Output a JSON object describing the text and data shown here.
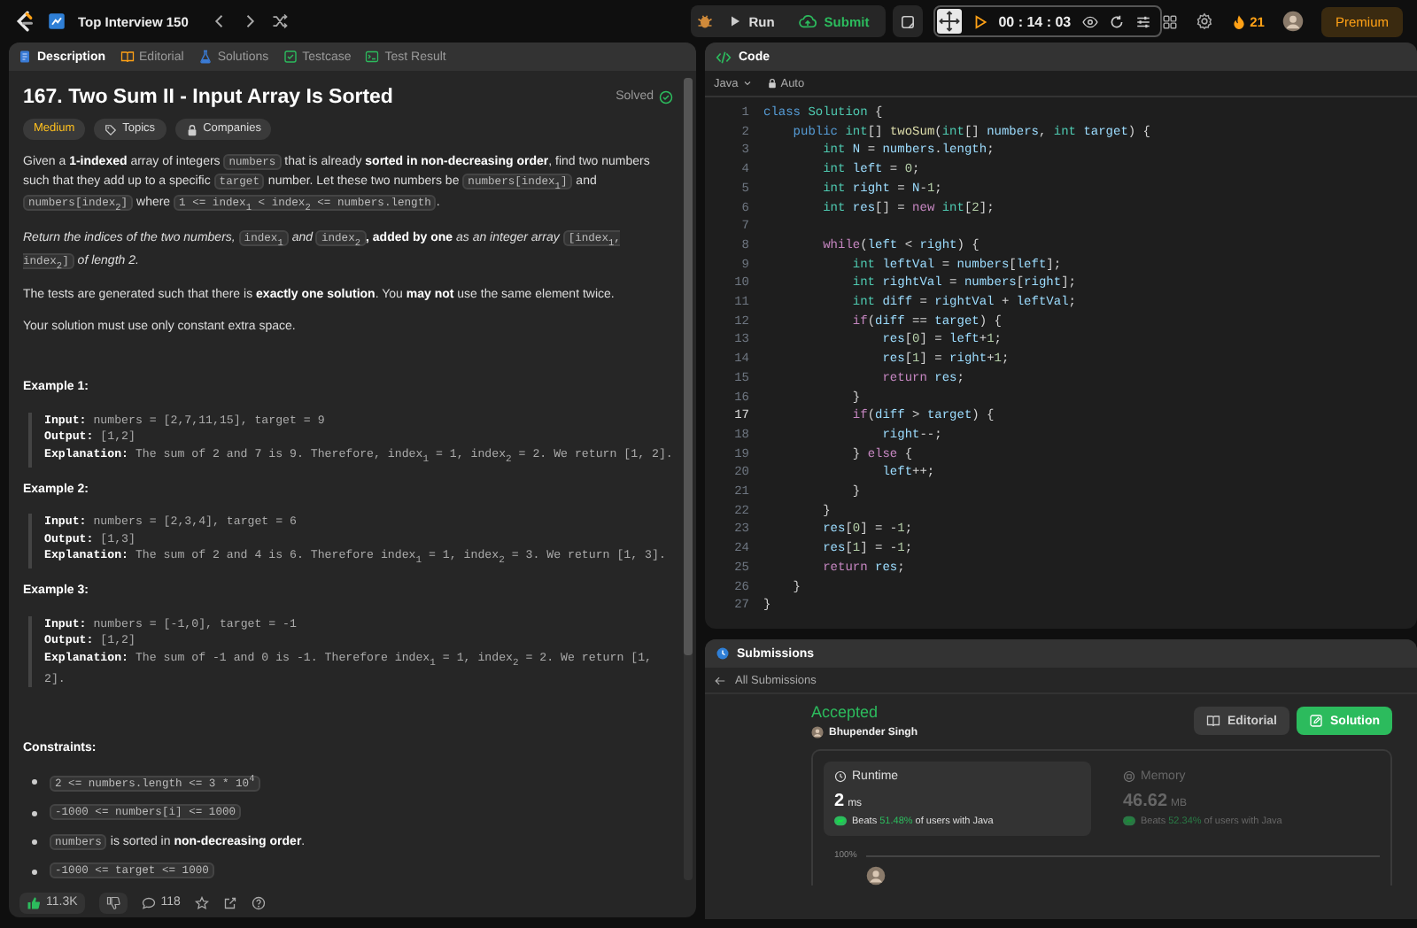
{
  "top_bar": {
    "list_title": "Top Interview 150",
    "run_label": "Run",
    "submit_label": "Submit",
    "timer": "00 : 14 : 03",
    "streak": "21",
    "premium_label": "Premium"
  },
  "left_tabs": [
    {
      "label": "Description",
      "selected": true
    },
    {
      "label": "Editorial",
      "selected": false
    },
    {
      "label": "Solutions",
      "selected": false
    },
    {
      "label": "Testcase",
      "selected": false
    },
    {
      "label": "Test Result",
      "selected": false
    }
  ],
  "problem": {
    "title": "167. Two Sum II - Input Array Is Sorted",
    "status": "Solved",
    "difficulty": "Medium",
    "tags": [
      {
        "label": "Topics",
        "kind": "topic"
      },
      {
        "label": "Companies",
        "kind": "company"
      }
    ],
    "paragraphs": [
      [
        {
          "kind": "text",
          "text": "Given a **1-indexed** array of integers "
        },
        {
          "kind": "code",
          "text": "numbers"
        },
        {
          "kind": "text",
          "text": " that is already **sorted in non-decreasing order**, find two numbers such that they add up to a specific "
        },
        {
          "kind": "code",
          "text": "target"
        },
        {
          "kind": "text",
          "text": " number. Let these two numbers be "
        },
        {
          "kind": "code",
          "text": "numbers[index$_{1}$]"
        },
        {
          "kind": "text",
          "text": " and "
        },
        {
          "kind": "code",
          "text": "numbers[index$_{2}$]"
        },
        {
          "kind": "text",
          "text": " where "
        },
        {
          "kind": "code",
          "text": "1 <= index$_{1}$ < index$_{2}$ <= numbers.length"
        },
        {
          "kind": "text",
          "text": "."
        }
      ],
      [
        {
          "kind": "text",
          "text": "*Return the indices of the two numbers,* "
        },
        {
          "kind": "code",
          "text": "index$_{1}$"
        },
        {
          "kind": "text",
          "text": " *and* "
        },
        {
          "kind": "code",
          "text": "index$_{2}$"
        },
        {
          "kind": "text",
          "text": "**, added by one** *as an integer array* "
        },
        {
          "kind": "code",
          "text": "[index$_{1}$, index$_{2}$]"
        },
        {
          "kind": "text",
          "text": " *of length 2.*"
        }
      ],
      [
        {
          "kind": "text",
          "text": "The tests are generated such that there is **exactly one solution**. You **may not** use the same element twice."
        }
      ],
      [
        {
          "kind": "text",
          "text": "Your solution must use only constant extra space."
        }
      ]
    ],
    "examples": [
      {
        "heading": "Example 1:",
        "lines": [
          {
            "label": "Input:",
            "text": "numbers = [2,7,11,15], target = 9"
          },
          {
            "label": "Output:",
            "text": "[1,2]"
          },
          {
            "label": "Explanation:",
            "text": "The sum of 2 and 7 is 9. Therefore, index$_{1}$ = 1, index$_{2}$ = 2. We return [1, 2]."
          }
        ]
      },
      {
        "heading": "Example 2:",
        "lines": [
          {
            "label": "Input:",
            "text": "numbers = [2,3,4], target = 6"
          },
          {
            "label": "Output:",
            "text": "[1,3]"
          },
          {
            "label": "Explanation:",
            "text": "The sum of 2 and 4 is 6. Therefore index$_{1}$ = 1, index$_{2}$ = 3. We return [1, 3]."
          }
        ]
      },
      {
        "heading": "Example 3:",
        "lines": [
          {
            "label": "Input:",
            "text": "numbers = [-1,0], target = -1"
          },
          {
            "label": "Output:",
            "text": "[1,2]"
          },
          {
            "label": "Explanation:",
            "text": "The sum of -1 and 0 is -1. Therefore index$_{1}$ = 1, index$_{2}$ = 2. We return [1, 2]."
          }
        ]
      }
    ],
    "constraints_heading": "Constraints:",
    "constraints": [
      [
        {
          "kind": "code",
          "text": "2 <= numbers.length <= 3 * 10$^{4}$"
        }
      ],
      [
        {
          "kind": "code",
          "text": "-1000 <= numbers[i] <= 1000"
        }
      ],
      [
        {
          "kind": "code",
          "text": "numbers"
        },
        {
          "kind": "text",
          "text": " is sorted in **non-decreasing order**."
        }
      ],
      [
        {
          "kind": "code",
          "text": "-1000 <= target <= 1000"
        }
      ]
    ]
  },
  "footer": {
    "likes": "11.3K",
    "comments": "118"
  },
  "code_panel": {
    "title": "Code",
    "language": "Java",
    "mode": "Auto",
    "lines": [
      {
        "number": "1",
        "active": false,
        "tokens": [
          {
            "kind": "storage",
            "text": "class "
          },
          {
            "kind": "type",
            "text": "Solution"
          },
          {
            "kind": "plain",
            "text": " {"
          }
        ]
      },
      {
        "number": "2",
        "active": false,
        "tokens": [
          {
            "kind": "storage",
            "text": "    public "
          },
          {
            "kind": "type",
            "text": "int"
          },
          {
            "kind": "plain",
            "text": "[] "
          },
          {
            "kind": "func",
            "text": "twoSum"
          },
          {
            "kind": "plain",
            "text": "("
          },
          {
            "kind": "type",
            "text": "int"
          },
          {
            "kind": "plain",
            "text": "[] "
          },
          {
            "kind": "var",
            "text": "numbers"
          },
          {
            "kind": "plain",
            "text": ", "
          },
          {
            "kind": "type",
            "text": "int"
          },
          {
            "kind": "var",
            "text": " target"
          },
          {
            "kind": "plain",
            "text": ") {"
          }
        ]
      },
      {
        "number": "3",
        "active": false,
        "tokens": [
          {
            "kind": "type",
            "text": "        int"
          },
          {
            "kind": "var",
            "text": " N"
          },
          {
            "kind": "plain",
            "text": " = "
          },
          {
            "kind": "var",
            "text": "numbers"
          },
          {
            "kind": "plain",
            "text": "."
          },
          {
            "kind": "var",
            "text": "length"
          },
          {
            "kind": "plain",
            "text": ";"
          }
        ]
      },
      {
        "number": "4",
        "active": false,
        "tokens": [
          {
            "kind": "type",
            "text": "        int"
          },
          {
            "kind": "var",
            "text": " left"
          },
          {
            "kind": "plain",
            "text": " = "
          },
          {
            "kind": "num",
            "text": "0"
          },
          {
            "kind": "plain",
            "text": ";"
          }
        ]
      },
      {
        "number": "5",
        "active": false,
        "tokens": [
          {
            "kind": "type",
            "text": "        int"
          },
          {
            "kind": "var",
            "text": " right"
          },
          {
            "kind": "plain",
            "text": " = "
          },
          {
            "kind": "var",
            "text": "N"
          },
          {
            "kind": "plain",
            "text": "-"
          },
          {
            "kind": "num",
            "text": "1"
          },
          {
            "kind": "plain",
            "text": ";"
          }
        ]
      },
      {
        "number": "6",
        "active": false,
        "tokens": [
          {
            "kind": "type",
            "text": "        int"
          },
          {
            "kind": "var",
            "text": " res"
          },
          {
            "kind": "plain",
            "text": "[] = "
          },
          {
            "kind": "control",
            "text": "new"
          },
          {
            "kind": "type",
            "text": " int"
          },
          {
            "kind": "plain",
            "text": "["
          },
          {
            "kind": "num",
            "text": "2"
          },
          {
            "kind": "plain",
            "text": "];"
          }
        ]
      },
      {
        "number": "7",
        "active": false
      },
      {
        "number": "8",
        "active": false,
        "tokens": [
          {
            "kind": "control",
            "text": "        while"
          },
          {
            "kind": "plain",
            "text": "("
          },
          {
            "kind": "var",
            "text": "left"
          },
          {
            "kind": "plain",
            "text": " < "
          },
          {
            "kind": "var",
            "text": "right"
          },
          {
            "kind": "plain",
            "text": ") {"
          }
        ]
      },
      {
        "number": "9",
        "active": false,
        "tokens": [
          {
            "kind": "type",
            "text": "            int"
          },
          {
            "kind": "var",
            "text": " leftVal"
          },
          {
            "kind": "plain",
            "text": " = "
          },
          {
            "kind": "var",
            "text": "numbers"
          },
          {
            "kind": "plain",
            "text": "["
          },
          {
            "kind": "var",
            "text": "left"
          },
          {
            "kind": "plain",
            "text": "];"
          }
        ]
      },
      {
        "number": "10",
        "active": false,
        "tokens": [
          {
            "kind": "type",
            "text": "            int"
          },
          {
            "kind": "var",
            "text": " rightVal"
          },
          {
            "kind": "plain",
            "text": " = "
          },
          {
            "kind": "var",
            "text": "numbers"
          },
          {
            "kind": "plain",
            "text": "["
          },
          {
            "kind": "var",
            "text": "right"
          },
          {
            "kind": "plain",
            "text": "];"
          }
        ]
      },
      {
        "number": "11",
        "active": false,
        "tokens": [
          {
            "kind": "type",
            "text": "            int"
          },
          {
            "kind": "var",
            "text": " diff"
          },
          {
            "kind": "plain",
            "text": " = "
          },
          {
            "kind": "var",
            "text": "rightVal"
          },
          {
            "kind": "plain",
            "text": " + "
          },
          {
            "kind": "var",
            "text": "leftVal"
          },
          {
            "kind": "plain",
            "text": ";"
          }
        ]
      },
      {
        "number": "12",
        "active": false,
        "tokens": [
          {
            "kind": "control",
            "text": "            if"
          },
          {
            "kind": "plain",
            "text": "("
          },
          {
            "kind": "var",
            "text": "diff"
          },
          {
            "kind": "plain",
            "text": " == "
          },
          {
            "kind": "var",
            "text": "target"
          },
          {
            "kind": "plain",
            "text": ") {"
          }
        ]
      },
      {
        "number": "13",
        "active": false,
        "tokens": [
          {
            "kind": "var",
            "text": "                res"
          },
          {
            "kind": "plain",
            "text": "["
          },
          {
            "kind": "num",
            "text": "0"
          },
          {
            "kind": "plain",
            "text": "] = "
          },
          {
            "kind": "var",
            "text": "left"
          },
          {
            "kind": "plain",
            "text": "+"
          },
          {
            "kind": "num",
            "text": "1"
          },
          {
            "kind": "plain",
            "text": ";"
          }
        ]
      },
      {
        "number": "14",
        "active": false,
        "tokens": [
          {
            "kind": "var",
            "text": "                res"
          },
          {
            "kind": "plain",
            "text": "["
          },
          {
            "kind": "num",
            "text": "1"
          },
          {
            "kind": "plain",
            "text": "] = "
          },
          {
            "kind": "var",
            "text": "right"
          },
          {
            "kind": "plain",
            "text": "+"
          },
          {
            "kind": "num",
            "text": "1"
          },
          {
            "kind": "plain",
            "text": ";"
          }
        ]
      },
      {
        "number": "15",
        "active": false,
        "tokens": [
          {
            "kind": "control",
            "text": "                return"
          },
          {
            "kind": "var",
            "text": " res"
          },
          {
            "kind": "plain",
            "text": ";"
          }
        ]
      },
      {
        "number": "16",
        "active": false,
        "tokens": [
          {
            "kind": "plain",
            "text": "            }"
          }
        ]
      },
      {
        "number": "17",
        "active": true,
        "tokens": [
          {
            "kind": "control",
            "text": "            if"
          },
          {
            "kind": "plain",
            "text": "("
          },
          {
            "kind": "var",
            "text": "diff"
          },
          {
            "kind": "plain",
            "text": " > "
          },
          {
            "kind": "var",
            "text": "target"
          },
          {
            "kind": "plain",
            "text": ") {"
          }
        ]
      },
      {
        "number": "18",
        "active": false,
        "tokens": [
          {
            "kind": "var",
            "text": "                right"
          },
          {
            "kind": "plain",
            "text": "--;"
          }
        ]
      },
      {
        "number": "19",
        "active": false,
        "tokens": [
          {
            "kind": "plain",
            "text": "            } "
          },
          {
            "kind": "control",
            "text": "else"
          },
          {
            "kind": "plain",
            "text": " {"
          }
        ]
      },
      {
        "number": "20",
        "active": false,
        "tokens": [
          {
            "kind": "var",
            "text": "                left"
          },
          {
            "kind": "plain",
            "text": "++;"
          }
        ]
      },
      {
        "number": "21",
        "active": false,
        "tokens": [
          {
            "kind": "plain",
            "text": "            }"
          }
        ]
      },
      {
        "number": "22",
        "active": false,
        "tokens": [
          {
            "kind": "plain",
            "text": "        }"
          }
        ]
      },
      {
        "number": "23",
        "active": false,
        "tokens": [
          {
            "kind": "var",
            "text": "        res"
          },
          {
            "kind": "plain",
            "text": "["
          },
          {
            "kind": "num",
            "text": "0"
          },
          {
            "kind": "plain",
            "text": "] = -"
          },
          {
            "kind": "num",
            "text": "1"
          },
          {
            "kind": "plain",
            "text": ";"
          }
        ]
      },
      {
        "number": "24",
        "active": false,
        "tokens": [
          {
            "kind": "var",
            "text": "        res"
          },
          {
            "kind": "plain",
            "text": "["
          },
          {
            "kind": "num",
            "text": "1"
          },
          {
            "kind": "plain",
            "text": "] = -"
          },
          {
            "kind": "num",
            "text": "1"
          },
          {
            "kind": "plain",
            "text": ";"
          }
        ]
      },
      {
        "number": "25",
        "active": false,
        "tokens": [
          {
            "kind": "control",
            "text": "        return"
          },
          {
            "kind": "var",
            "text": " res"
          },
          {
            "kind": "plain",
            "text": ";"
          }
        ]
      },
      {
        "number": "26",
        "active": false,
        "tokens": [
          {
            "kind": "plain",
            "text": "    }"
          }
        ]
      },
      {
        "number": "27",
        "active": false,
        "tokens": [
          {
            "kind": "plain",
            "text": "}"
          }
        ]
      }
    ]
  },
  "submissions": {
    "title": "Submissions",
    "back_label": "All Submissions",
    "verdict": "Accepted",
    "author": "Bhupender Singh",
    "buttons": [
      {
        "label": "Editorial",
        "kind": "secondary"
      },
      {
        "label": "Solution",
        "kind": "primary"
      }
    ],
    "metrics": [
      {
        "kind": "runtime",
        "name": "Runtime",
        "value": "2",
        "unit": "ms",
        "beats_label": "Beats",
        "percent": "51.48%",
        "suffix": "of users with Java",
        "selected": true
      },
      {
        "kind": "memory",
        "name": "Memory",
        "value": "46.62",
        "unit": "MB",
        "beats_label": "Beats",
        "percent": "52.34%",
        "suffix": "of users with Java",
        "selected": false
      }
    ],
    "chart_tick_label": "100%"
  }
}
